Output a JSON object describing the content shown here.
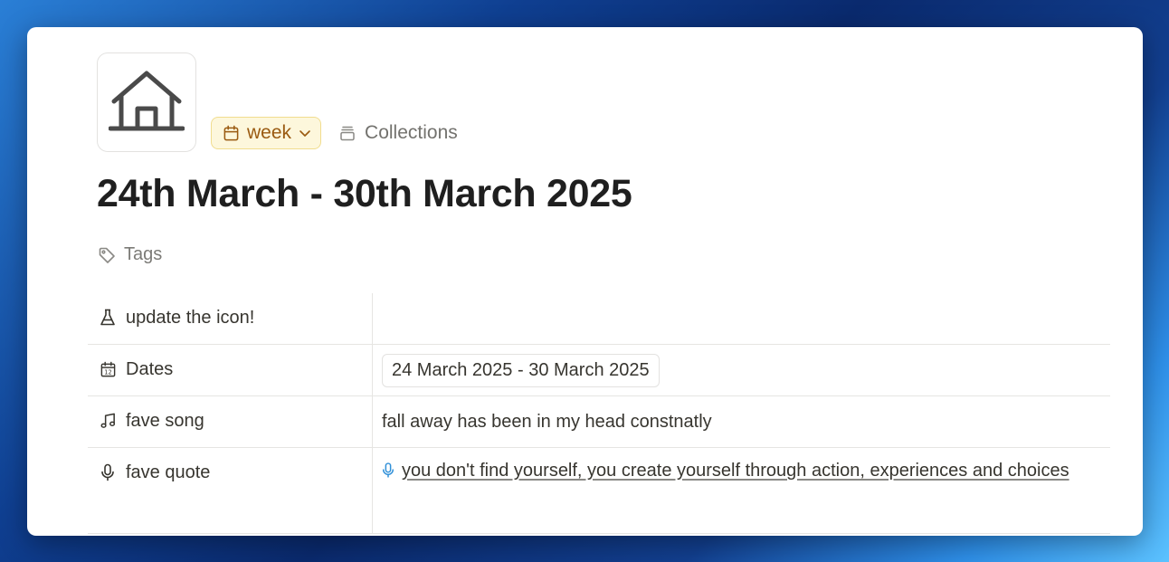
{
  "page": {
    "icon": "house-icon",
    "title": "24th March - 30th March 2025"
  },
  "meta": {
    "type_label": "week",
    "type_icon": "calendar-icon",
    "collections_label": "Collections",
    "collections_icon": "stack-icon"
  },
  "tags": {
    "label": "Tags",
    "icon": "tag-icon"
  },
  "properties": [
    {
      "name": "update the icon!",
      "icon": "flask-icon",
      "value": ""
    },
    {
      "name": "Dates",
      "icon": "calendar-date-icon",
      "value": "24 March 2025 - 30 March 2025"
    },
    {
      "name": "fave song",
      "icon": "music-note-icon",
      "value": "fall away has been in my head constnatly"
    },
    {
      "name": "fave quote",
      "icon": "microphone-icon",
      "value": "you don't find yourself, you create yourself through action, experiences and choices"
    }
  ],
  "colors": {
    "week_pill_bg": "#fdf7dc",
    "week_pill_text": "#9a5a10",
    "mic_accent": "#2f8fd8"
  }
}
